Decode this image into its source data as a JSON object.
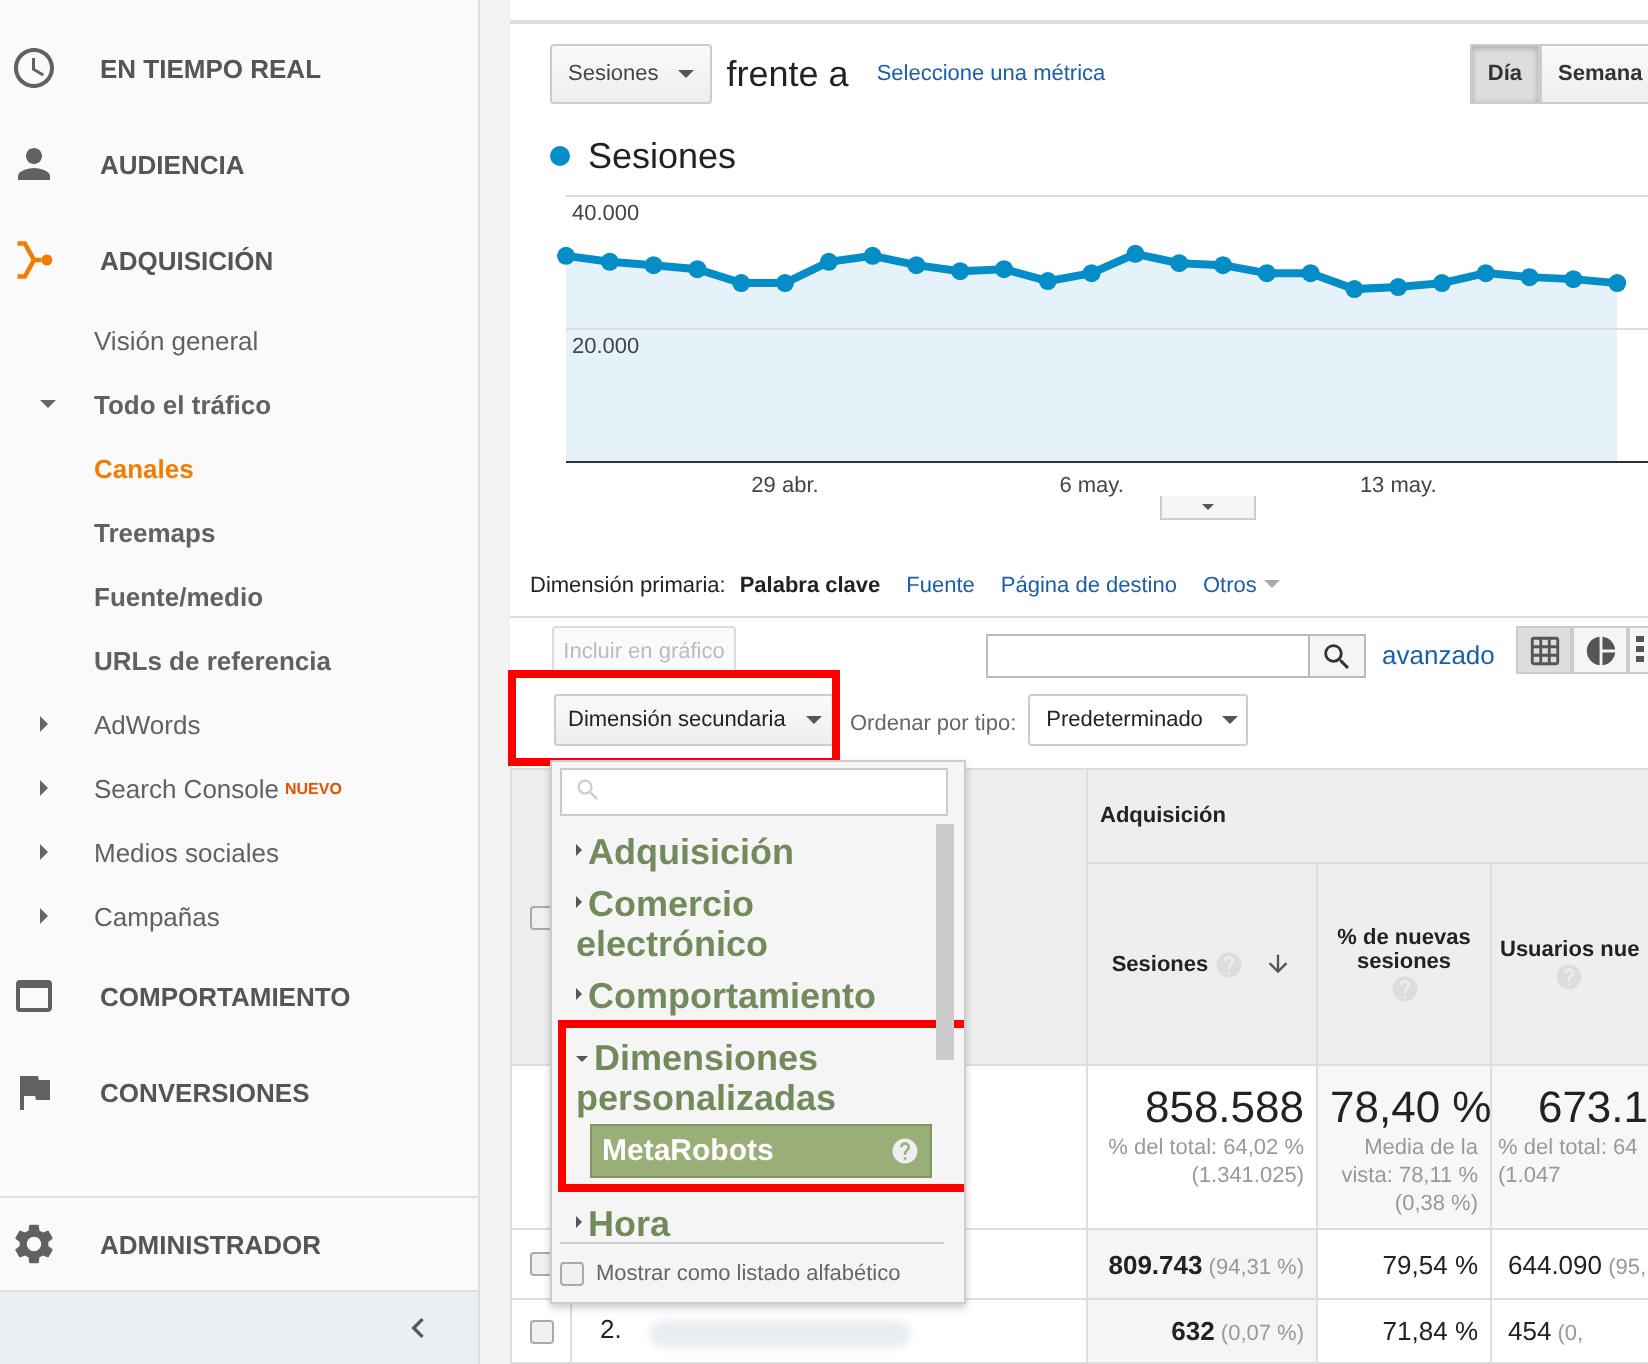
{
  "sidebar": {
    "sections": [
      {
        "label": "EN TIEMPO REAL",
        "selected": false
      },
      {
        "label": "AUDIENCIA",
        "selected": false
      },
      {
        "label": "ADQUISICIÓN",
        "selected": true,
        "children": [
          {
            "label": "Visión general",
            "selected": false
          },
          {
            "label": "Todo el tráfico",
            "selected": false,
            "expanded": true,
            "children": [
              {
                "label": "Canales",
                "selected": true
              },
              {
                "label": "Treemaps",
                "selected": false
              },
              {
                "label": "Fuente/medio",
                "selected": false
              },
              {
                "label": "URLs de referencia",
                "selected": false
              }
            ]
          },
          {
            "label": "AdWords",
            "selected": false,
            "expanded": false
          },
          {
            "label": "Search Console",
            "selected": false,
            "expanded": false,
            "badge": "NUEVO"
          },
          {
            "label": "Medios sociales",
            "selected": false,
            "expanded": false
          },
          {
            "label": "Campañas",
            "selected": false,
            "expanded": false
          }
        ]
      },
      {
        "label": "COMPORTAMIENTO",
        "selected": false
      },
      {
        "label": "CONVERSIONES",
        "selected": false
      }
    ],
    "admin": {
      "label": "ADMINISTRADOR"
    }
  },
  "chart_controls": {
    "metric": "Sesiones",
    "versus": "frente a",
    "select_metric_link": "Seleccione una métrica",
    "period_buttons": [
      {
        "label": "Día",
        "selected": true
      },
      {
        "label": "Semana",
        "selected": false
      }
    ]
  },
  "chart": {
    "chart_data": {
      "type": "area",
      "categories": [
        null,
        null,
        null,
        null,
        null,
        "29 abr.",
        null,
        null,
        null,
        null,
        null,
        null,
        "6 may.",
        null,
        null,
        null,
        null,
        null,
        null,
        "13 may.",
        null,
        null,
        null,
        null,
        null
      ],
      "series": [
        {
          "name": "Sesiones",
          "color": "#058dc7",
          "values": [
            31000,
            30100,
            29600,
            29000,
            26900,
            26900,
            30100,
            31000,
            29600,
            28700,
            29000,
            27200,
            28400,
            31300,
            29900,
            29600,
            28400,
            28400,
            26000,
            26300,
            26900,
            28400,
            27800,
            27500,
            26900
          ]
        }
      ],
      "ylim": [
        0,
        40000
      ],
      "yticks": [
        {
          "value": 20000,
          "label": "20.000"
        },
        {
          "value": 40000,
          "label": "40.000"
        }
      ]
    }
  },
  "primary_dimension": {
    "label": "Dimensión primaria:",
    "options": [
      {
        "label": "Palabra clave",
        "selected": true
      },
      {
        "label": "Fuente",
        "selected": false
      },
      {
        "label": "Página de destino",
        "selected": false
      },
      {
        "label": "Otros",
        "selected": false,
        "kind": "menu"
      }
    ]
  },
  "toolbar": {
    "plot_button": {
      "label": "Incluir en gráfico",
      "disabled": true
    },
    "advanced_link": "avanzado",
    "views": [
      {
        "selected": true
      },
      {
        "selected": false
      },
      {
        "selected": false
      }
    ],
    "secondary_dimension": {
      "label": "Dimensión secundaria",
      "highlighted": true
    },
    "sort_label": "Ordenar por tipo:",
    "sort_value": "Predeterminado"
  },
  "dimension_dropdown": {
    "groups": [
      {
        "label": "Adquisición",
        "expanded": false
      },
      {
        "label": "Comercio electrónico",
        "expanded": false
      },
      {
        "label": "Comportamiento",
        "expanded": false
      },
      {
        "label": "Dimensiones personalizadas",
        "expanded": true,
        "highlighted": true,
        "children": [
          {
            "label": "MetaRobots",
            "selected": true
          }
        ]
      },
      {
        "label": "Hora",
        "expanded": false
      }
    ],
    "alphabetical": {
      "label": "Mostrar como listado alfabético",
      "checked": false
    }
  },
  "table": {
    "group_header": "Adquisición",
    "select_all_checked": false,
    "columns": [
      {
        "label": "Sesiones",
        "sorted": true
      },
      {
        "label": "% de nuevas sesiones",
        "sorted": false
      },
      {
        "label": "Usuarios nue",
        "sorted": false
      }
    ],
    "totals": [
      {
        "value": "858.588",
        "note": [
          "% del total: 64,02 %",
          "(1.341.025)"
        ]
      },
      {
        "value": "78,40 %",
        "note": [
          "Media de la",
          "vista: 78,11 %",
          "(0,38 %)"
        ]
      },
      {
        "value": "673.1",
        "note": [
          "% del total: 64",
          "(1.047"
        ]
      }
    ],
    "rows": [
      {
        "checked": false,
        "cells": [
          {
            "value": "809.743",
            "share": "(94,31 %)"
          },
          {
            "value": "79,54 %"
          },
          {
            "value": "644.090",
            "share": "(95,"
          }
        ]
      },
      {
        "checked": false,
        "index": "2.",
        "cells": [
          {
            "value": "632",
            "share": "(0,07 %)"
          },
          {
            "value": "71,84 %"
          },
          {
            "value": "454",
            "share": "(0,"
          }
        ]
      }
    ]
  }
}
